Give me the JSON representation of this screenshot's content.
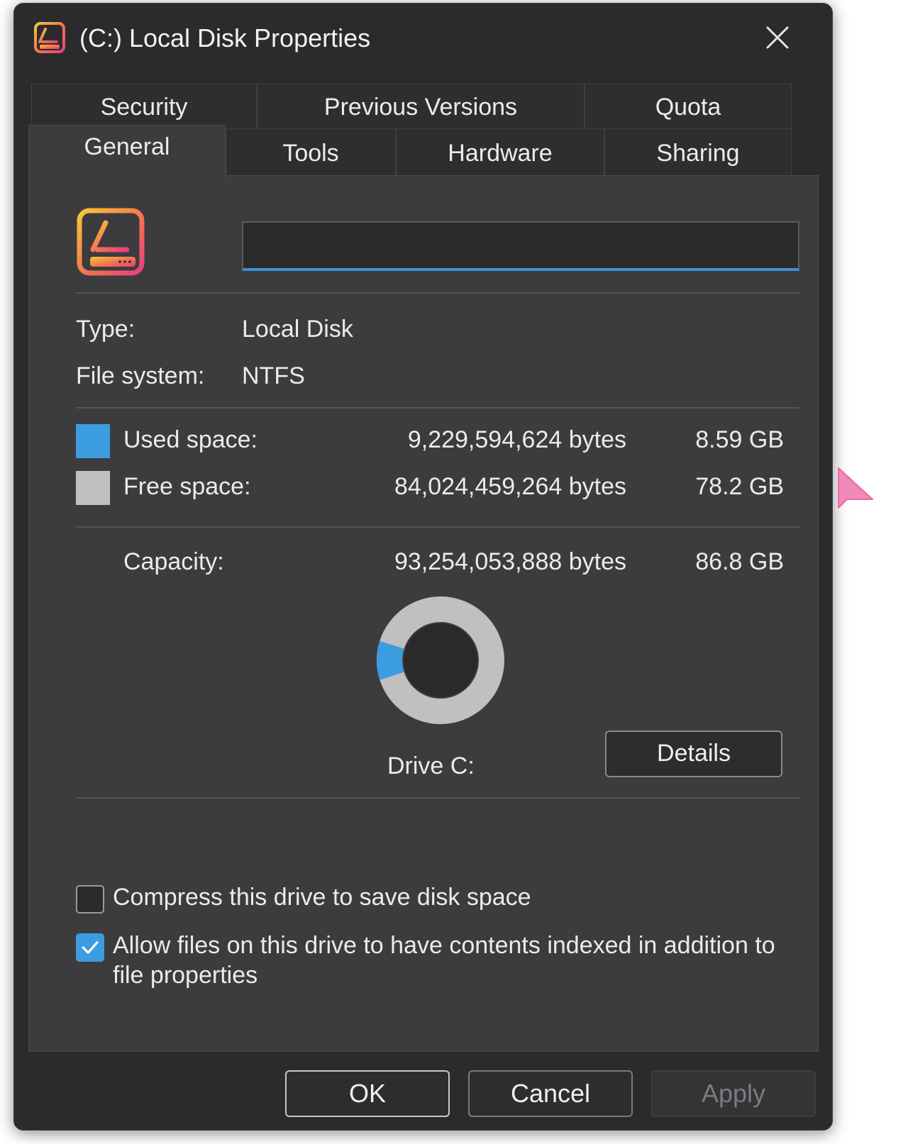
{
  "window": {
    "title": "(C:) Local Disk Properties"
  },
  "tabs": {
    "back_row": [
      "Security",
      "Previous Versions",
      "Quota"
    ],
    "front_row": [
      "General",
      "Tools",
      "Hardware",
      "Sharing"
    ],
    "active": "General"
  },
  "general": {
    "name_value": "",
    "type_label": "Type:",
    "type_value": "Local Disk",
    "fs_label": "File system:",
    "fs_value": "NTFS",
    "used_label": "Used space:",
    "used_bytes": "9,229,594,624 bytes",
    "used_size": "8.59 GB",
    "free_label": "Free space:",
    "free_bytes": "84,024,459,264 bytes",
    "free_size": "78.2 GB",
    "capacity_label": "Capacity:",
    "capacity_bytes": "93,254,053,888 bytes",
    "capacity_size": "86.8 GB",
    "drive_label": "Drive C:",
    "details_button": "Details",
    "compress_label": "Compress this drive to save disk space",
    "compress_checked": false,
    "index_label_line1": "Allow files on this drive to have contents indexed in addition to",
    "index_label_line2": "file properties",
    "index_checked": true
  },
  "usage_chart": {
    "used_fraction": 0.099,
    "used_color": "#3b9de0",
    "free_color": "#c0c0c0"
  },
  "footer": {
    "ok": "OK",
    "cancel": "Cancel",
    "apply": "Apply"
  },
  "icons": {
    "title": "drive-icon",
    "close": "close-icon",
    "drive": "drive-icon",
    "check": "checkmark-icon",
    "cursor": "pointer-cursor-icon"
  }
}
